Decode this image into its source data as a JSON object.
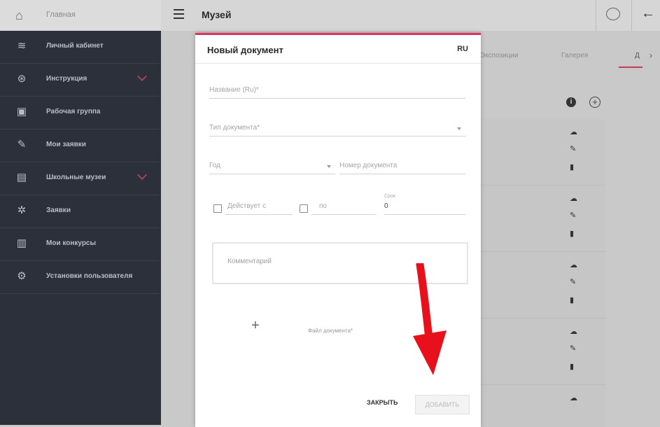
{
  "header": {
    "home_label": "Главная",
    "page_title": "Музей"
  },
  "sidebar": {
    "items": [
      {
        "label": "Личный кабинет",
        "icon": "layers-icon"
      },
      {
        "label": "Инструкция",
        "icon": "lifebuoy-icon",
        "expandable": true
      },
      {
        "label": "Рабочая группа",
        "icon": "group-icon"
      },
      {
        "label": "Мои заявки",
        "icon": "document-edit-icon"
      },
      {
        "label": "Школьные музеи",
        "icon": "museum-icon",
        "expandable": true
      },
      {
        "label": "Заявки",
        "icon": "badge-icon"
      },
      {
        "label": "Мои конкурсы",
        "icon": "contest-icon"
      },
      {
        "label": "Установки пользователя",
        "icon": "settings-icon"
      }
    ]
  },
  "tabs": [
    {
      "label": "Экспозиции"
    },
    {
      "label": "Галерея"
    },
    {
      "label": "Д"
    }
  ],
  "modal": {
    "title": "Новый документ",
    "lang": "RU",
    "name_placeholder": "Название (Ru)*",
    "type_placeholder": "Тип документа*",
    "year_placeholder": "Год",
    "number_placeholder": "Номер документа",
    "valid_from_placeholder": "Действует с",
    "valid_to_placeholder": "по",
    "term_label": "Срок",
    "term_value": "0",
    "comment_placeholder": "Комментарий",
    "file_label": "Файл документа*",
    "close_label": "ЗАКРЫТЬ",
    "add_label": "ДОБАВИТЬ"
  },
  "colors": {
    "accent": "#e0305e",
    "arrow": "#e8111b",
    "sidebar": "#2b303a"
  }
}
